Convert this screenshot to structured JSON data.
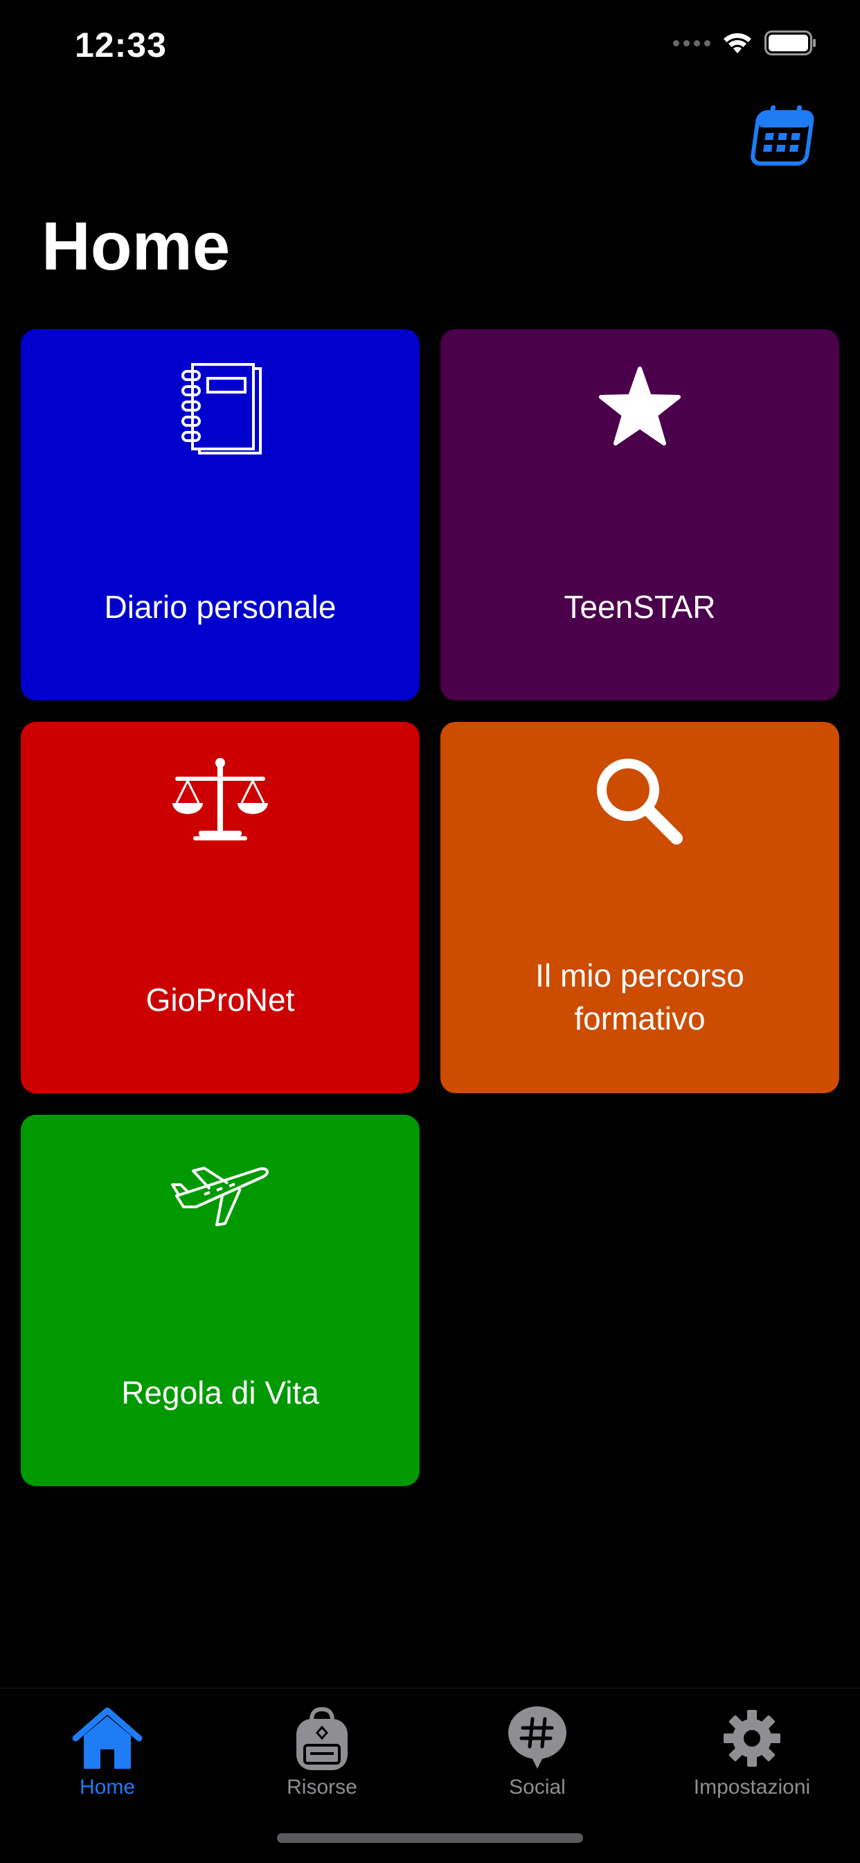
{
  "status_bar": {
    "time": "12:33"
  },
  "header": {
    "title": "Home",
    "calendar_icon": "calendar-icon",
    "accent_color": "#1e7cf6"
  },
  "tiles": [
    {
      "label": "Diario personale",
      "icon": "notebook-icon",
      "color": "#0000cc"
    },
    {
      "label": "TeenSTAR",
      "icon": "star-icon",
      "color": "#4a004a"
    },
    {
      "label": "GioProNet",
      "icon": "scales-icon",
      "color": "#cc0000"
    },
    {
      "label_line1": "Il mio percorso",
      "label_line2": "formativo",
      "icon": "magnifier-icon",
      "color": "#cc4c00"
    },
    {
      "label": "Regola di Vita",
      "icon": "airplane-icon",
      "color": "#009900"
    }
  ],
  "tab_bar": {
    "items": [
      {
        "label": "Home",
        "icon": "house-icon",
        "active": true
      },
      {
        "label": "Risorse",
        "icon": "backpack-icon",
        "active": false
      },
      {
        "label": "Social",
        "icon": "hashtag-bubble-icon",
        "active": false
      },
      {
        "label": "Impostazioni",
        "icon": "gear-icon",
        "active": false
      }
    ],
    "active_color": "#1e7cf6",
    "inactive_color": "#8e8e93"
  }
}
